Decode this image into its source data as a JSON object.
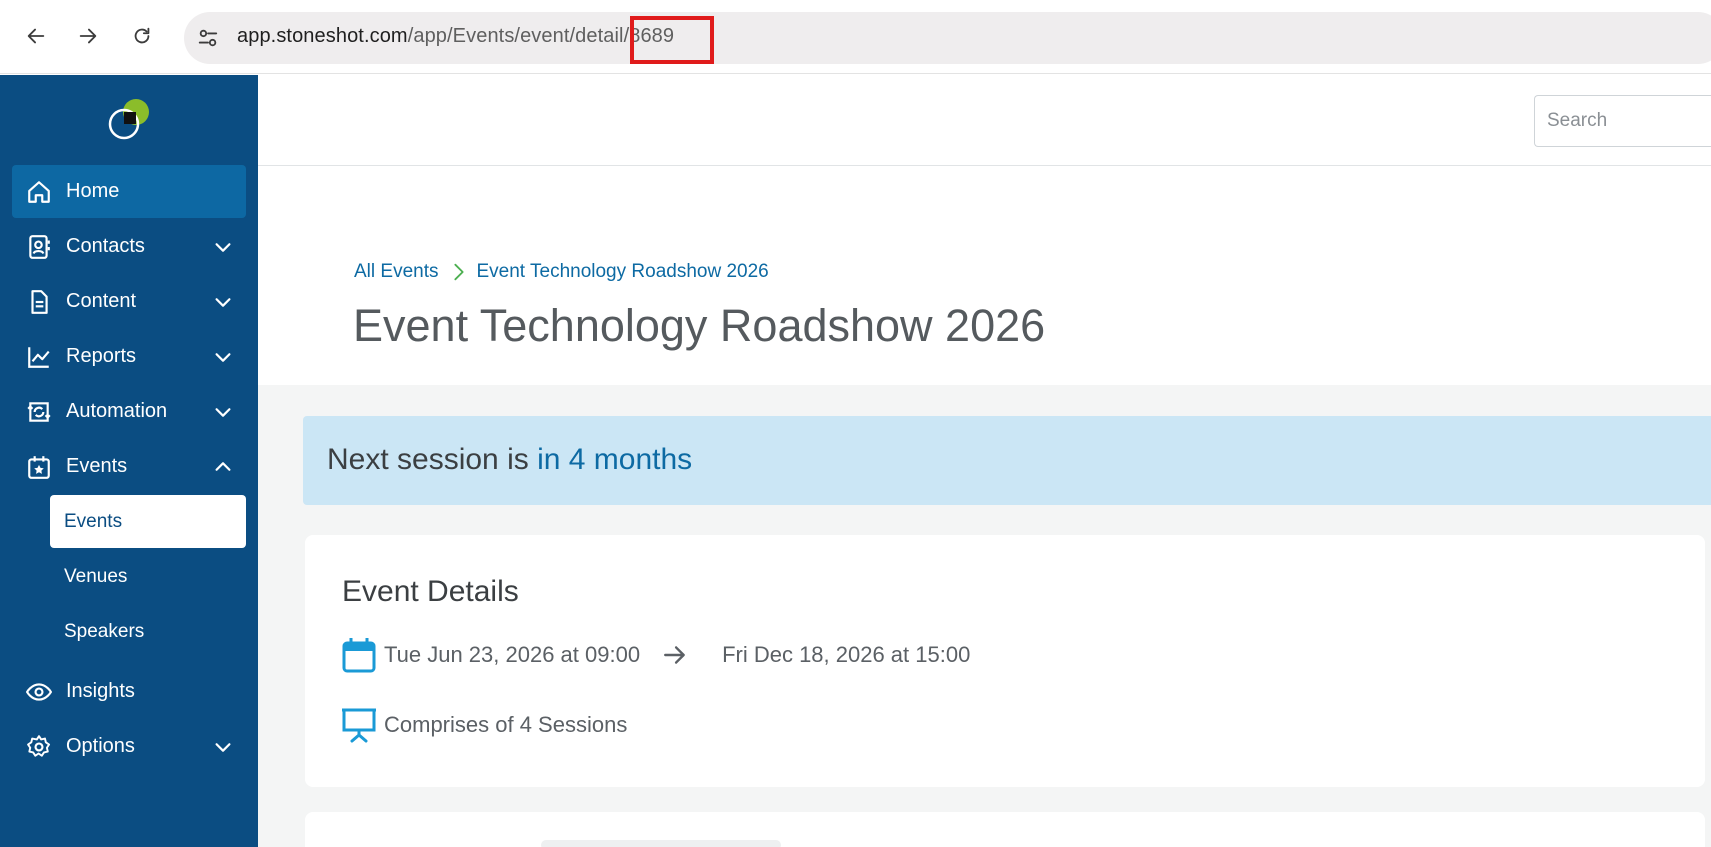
{
  "browser": {
    "url_host": "app.stoneshot.com",
    "url_path": "/app/Events/event/detail/8689"
  },
  "sidebar": {
    "items": [
      {
        "label": "Home",
        "icon": "home-icon",
        "active": true
      },
      {
        "label": "Contacts",
        "icon": "contacts-icon",
        "expandable": true
      },
      {
        "label": "Content",
        "icon": "document-icon",
        "expandable": true
      },
      {
        "label": "Reports",
        "icon": "chart-line-icon",
        "expandable": true
      },
      {
        "label": "Automation",
        "icon": "automation-icon",
        "expandable": true
      },
      {
        "label": "Events",
        "icon": "calendar-star-icon",
        "expanded": true
      },
      {
        "label": "Insights",
        "icon": "eye-icon"
      },
      {
        "label": "Options",
        "icon": "gear-icon",
        "expandable": true
      }
    ],
    "events_subitems": [
      {
        "label": "Events",
        "active": true
      },
      {
        "label": "Venues"
      },
      {
        "label": "Speakers"
      }
    ]
  },
  "topbar": {
    "search_placeholder": "Search"
  },
  "breadcrumb": {
    "root": "All Events",
    "current": "Event Technology Roadshow 2026"
  },
  "page": {
    "title": "Event Technology Roadshow 2026"
  },
  "banner": {
    "prefix": "Next session is ",
    "accent": "in 4 months"
  },
  "details": {
    "title": "Event Details",
    "start": "Tue Jun 23, 2026 at 09:00",
    "end": "Fri Dec 18, 2026 at 15:00",
    "sessions": "Comprises of 4 Sessions"
  },
  "colors": {
    "sidebar": "#0b4d82",
    "active_nav": "#0d68a3",
    "link": "#0d6aa3",
    "banner": "#cbe6f5",
    "highlight": "#e01b1b",
    "breadcrumb_chevron": "#4caf50",
    "logo_green": "#8bbd2a"
  }
}
